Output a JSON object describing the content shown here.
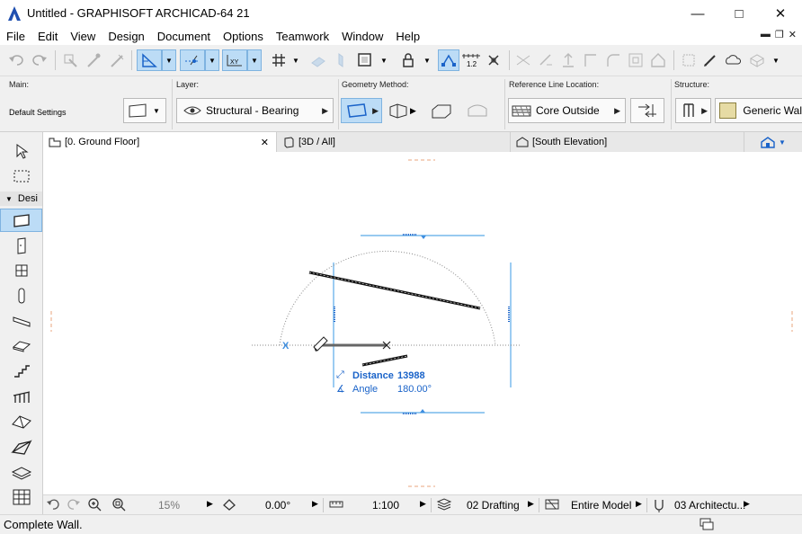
{
  "window": {
    "title": "Untitled - GRAPHISOFT ARCHICAD-64 21"
  },
  "menu": [
    "File",
    "Edit",
    "View",
    "Design",
    "Document",
    "Options",
    "Teamwork",
    "Window",
    "Help"
  ],
  "infobox": {
    "main_label": "Main:",
    "main_value": "Default Settings",
    "layer_label": "Layer:",
    "layer_value": "Structural - Bearing",
    "geometry_label": "Geometry Method:",
    "refline_label": "Reference Line Location:",
    "refline_value": "Core Outside",
    "structure_label": "Structure:",
    "structure_value": "Generic Wal"
  },
  "toolbox": {
    "section_label": "Desi"
  },
  "tabs": [
    {
      "label": "[0. Ground Floor]"
    },
    {
      "label": "[3D / All]"
    },
    {
      "label": "[South Elevation]"
    }
  ],
  "tracker": {
    "distance_label": "Distance",
    "distance_value": "13988",
    "angle_label": "Angle",
    "angle_value": "180.00°"
  },
  "canvas": {
    "origin_mark": "X"
  },
  "status": {
    "zoom": "15%",
    "angle": "0.00°",
    "scale": "1:100",
    "layer_combo": "02 Drafting",
    "model_filter": "Entire Model",
    "pen_set": "03 Architectu..."
  },
  "bottom_message": "Complete Wall.",
  "colors": {
    "accent": "#3d8ee0",
    "selected_bg": "#bcdcf6",
    "tracker_blue": "#1a63c9"
  }
}
